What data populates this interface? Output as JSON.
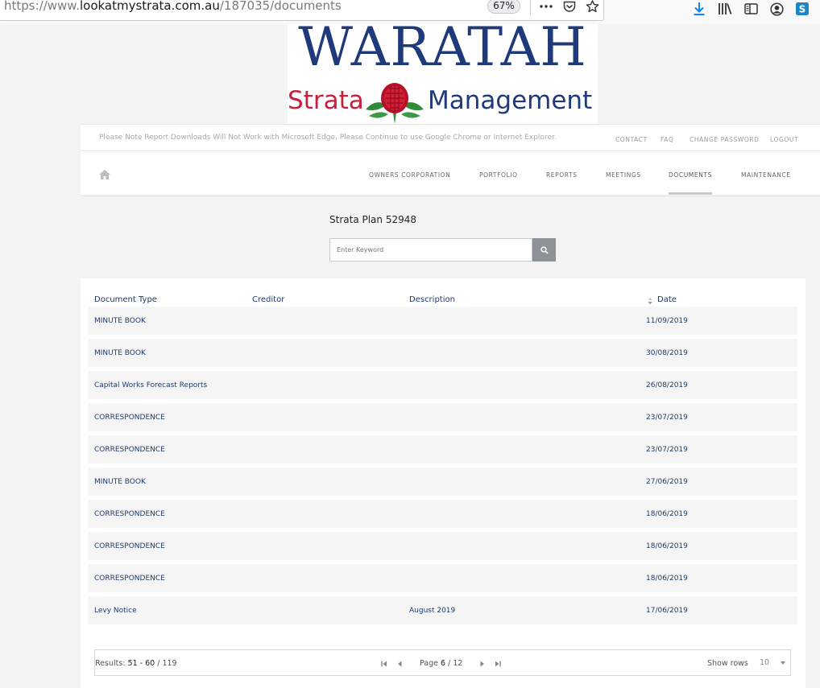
{
  "browser": {
    "url_prefix": "https://www.",
    "url_domain": "lookatmystrata.com.au",
    "url_path": "/187035/documents",
    "zoom": "67%",
    "more_icon": "more-icon",
    "pocket_icon": "pocket-icon",
    "bookmark_icon": "star-icon"
  },
  "logo": {
    "title": "WARATAH",
    "word_left": "Strata",
    "word_right": "Management"
  },
  "notice": "Please Note Report Downloads Will Not Work with Microsoft Edge, Please Continue to use Google Chrome or Internet Explorer.",
  "top_links": [
    "CONTACT",
    "FAQ",
    "CHANGE PASSWORD",
    "LOGOUT"
  ],
  "nav": {
    "items": [
      "OWNERS CORPORATION",
      "PORTFOLIO",
      "REPORTS",
      "MEETINGS",
      "DOCUMENTS",
      "MAINTENANCE"
    ],
    "active": "DOCUMENTS"
  },
  "search": {
    "plan_title": "Strata Plan 52948",
    "placeholder": "Enter Keyword"
  },
  "table": {
    "columns": [
      "Document Type",
      "Creditor",
      "Description",
      "Date"
    ],
    "rows": [
      {
        "type": "MINUTE BOOK",
        "creditor": "",
        "description": "",
        "date": "11/09/2019"
      },
      {
        "type": "MINUTE BOOK",
        "creditor": "",
        "description": "",
        "date": "30/08/2019"
      },
      {
        "type": "Capital Works Forecast Reports",
        "creditor": "",
        "description": "",
        "date": "26/08/2019"
      },
      {
        "type": "CORRESPONDENCE",
        "creditor": "",
        "description": "",
        "date": "23/07/2019"
      },
      {
        "type": "CORRESPONDENCE",
        "creditor": "",
        "description": "",
        "date": "23/07/2019"
      },
      {
        "type": "MINUTE BOOK",
        "creditor": "",
        "description": "",
        "date": "27/06/2019"
      },
      {
        "type": "CORRESPONDENCE",
        "creditor": "",
        "description": "",
        "date": "18/06/2019"
      },
      {
        "type": "CORRESPONDENCE",
        "creditor": "",
        "description": "",
        "date": "18/06/2019"
      },
      {
        "type": "CORRESPONDENCE",
        "creditor": "",
        "description": "",
        "date": "18/06/2019"
      },
      {
        "type": "Levy Notice",
        "creditor": "",
        "description": "August 2019",
        "date": "17/06/2019"
      }
    ]
  },
  "pager": {
    "results_label": "Results:",
    "range": "51 - 60",
    "total": "/ 119",
    "page_label": "Page",
    "page": "6",
    "pages": "/ 12",
    "show_rows_label": "Show rows",
    "rows_value": "10"
  },
  "colors": {
    "brand_blue": "#1f3a7a",
    "brand_red": "#c8203a",
    "link_navy": "#1f3a6b"
  }
}
